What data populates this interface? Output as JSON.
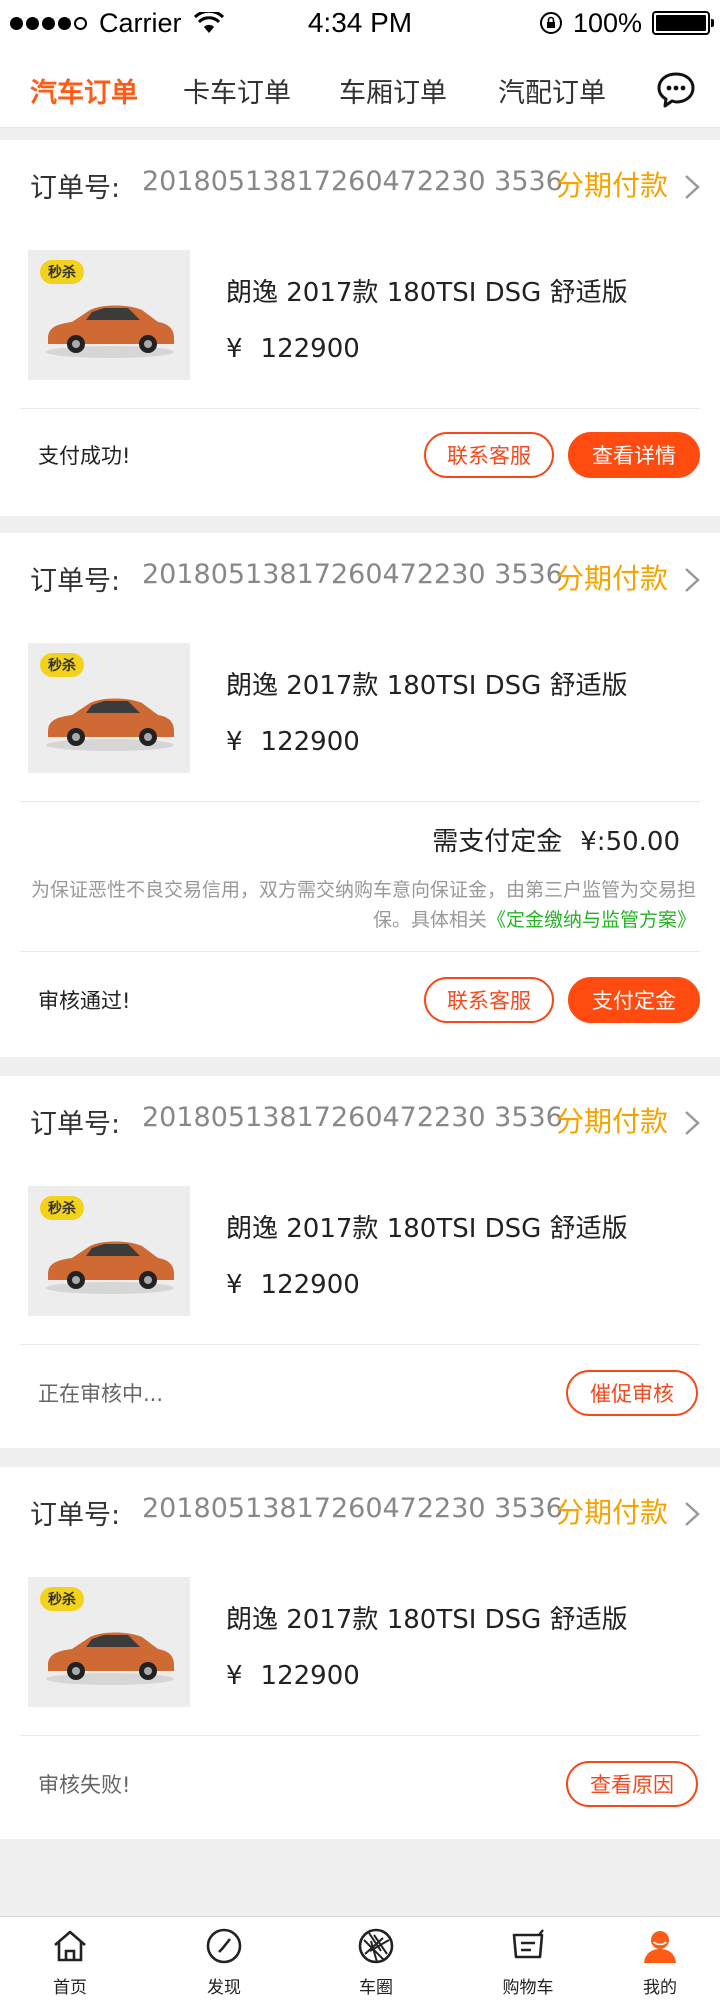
{
  "status_bar": {
    "carrier": "Carrier",
    "time": "4:34 PM",
    "battery": "100%"
  },
  "tabs": [
    {
      "label": "汽车订单",
      "active": true
    },
    {
      "label": "卡车订单",
      "active": false
    },
    {
      "label": "车厢订单",
      "active": false
    },
    {
      "label": "汽配订单",
      "active": false
    }
  ],
  "orders": [
    {
      "label": "订单号:",
      "number": "20180513817260472230 3536",
      "payment_type": "分期付款",
      "badge": "秒杀",
      "product": "朗逸  2017款 180TSI DSG 舒适版",
      "currency": "¥",
      "price": "122900",
      "status": "支付成功!",
      "buttons": [
        "联系客服",
        "查看详情"
      ]
    },
    {
      "label": "订单号:",
      "number": "20180513817260472230 3536",
      "payment_type": "分期付款",
      "badge": "秒杀",
      "product": "朗逸  2017款 180TSI DSG 舒适版",
      "currency": "¥",
      "price": "122900",
      "deposit_label": "需支付定金",
      "deposit_amount": "¥:50.00",
      "note_text": "为保证恶性不良交易信用，双方需交纳购车意向保证金，由第三户监管为交易担保。具体相关",
      "note_link": "《定金缴纳与监管方案》",
      "status": "审核通过!",
      "buttons": [
        "联系客服",
        "支付定金"
      ]
    },
    {
      "label": "订单号:",
      "number": "20180513817260472230 3536",
      "payment_type": "分期付款",
      "badge": "秒杀",
      "product": "朗逸  2017款 180TSI DSG 舒适版",
      "currency": "¥",
      "price": "122900",
      "status": "正在审核中...",
      "buttons": [
        "催促审核"
      ]
    },
    {
      "label": "订单号:",
      "number": "20180513817260472230 3536",
      "payment_type": "分期付款",
      "badge": "秒杀",
      "product": "朗逸  2017款 180TSI DSG 舒适版",
      "currency": "¥",
      "price": "122900",
      "status": "审核失败!",
      "buttons": [
        "查看原因"
      ]
    }
  ],
  "tabbar": [
    {
      "label": "首页",
      "icon": "home-icon"
    },
    {
      "label": "发现",
      "icon": "compass-icon"
    },
    {
      "label": "车圈",
      "icon": "aperture-icon"
    },
    {
      "label": "购物车",
      "icon": "cart-icon"
    },
    {
      "label": "我的",
      "icon": "user-icon",
      "active": true
    }
  ],
  "colors": {
    "accent": "#fe5b15",
    "installment": "#f5a300",
    "button": "#ff4a10",
    "link": "#27b227",
    "badge": "#f3d21b"
  }
}
